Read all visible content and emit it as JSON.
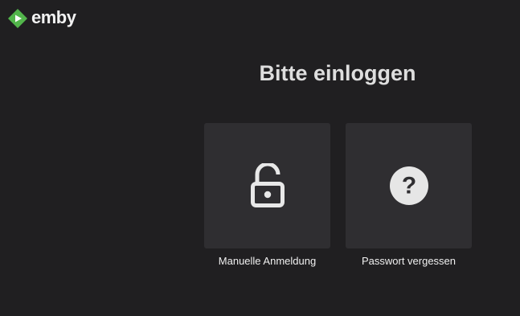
{
  "app": {
    "logo_text": "emby",
    "logo_icon": "emby-play-diamond-icon",
    "brand_color": "#52b54b"
  },
  "main": {
    "title": "Bitte einloggen",
    "options": [
      {
        "label": "Manuelle Anmeldung",
        "icon": "lock-open-icon"
      },
      {
        "label": "Passwort vergessen",
        "icon": "question-circle-icon"
      }
    ]
  }
}
